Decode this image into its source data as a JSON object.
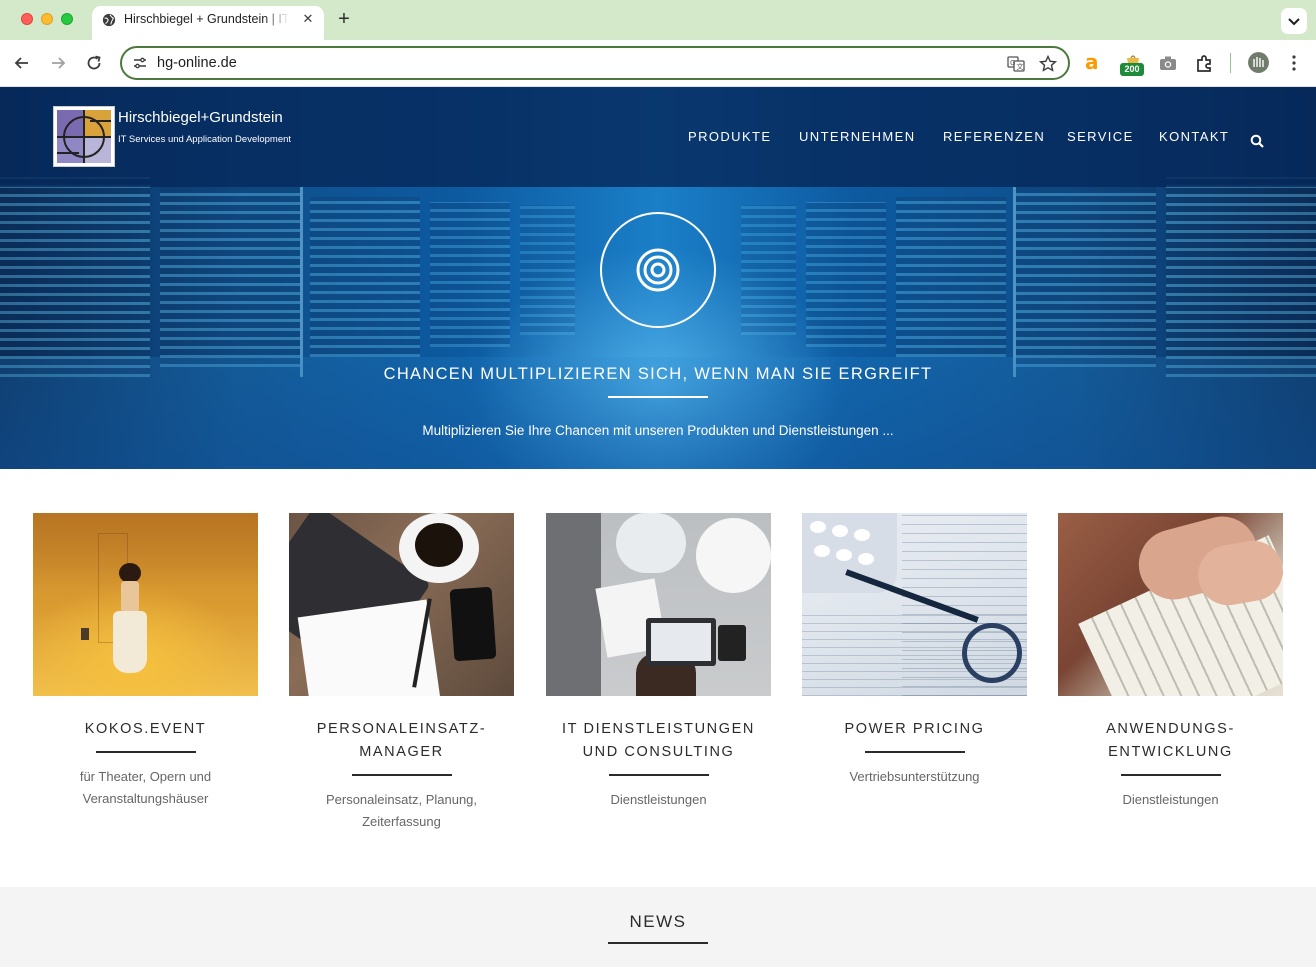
{
  "browser": {
    "tab_title": "Hirschbiegel + Grundstein | IT Services",
    "url": "hg-online.de",
    "extension_badge": "200"
  },
  "site": {
    "logo_name": "Hirschbiegel+Grundstein",
    "logo_tagline": "IT Services und Application Development",
    "menu": [
      "PRODUKTE",
      "UNTERNEHMEN",
      "REFERENZEN",
      "SERVICE",
      "KONTAKT"
    ]
  },
  "hero": {
    "title": "CHANCEN MULTIPLIZIEREN SICH, WENN MAN SIE ERGREIFT",
    "subtitle": "Multiplizieren Sie Ihre Chancen mit unseren Produkten und Dienstleistungen ..."
  },
  "cards": [
    {
      "title": "KOKOS.EVENT",
      "desc": "für Theater, Opern und Veranstaltungshäuser"
    },
    {
      "title": "PERSONALEINSATZ-MANAGER",
      "desc": "Personaleinsatz, Planung, Zeiterfassung"
    },
    {
      "title": "IT DIENSTLEISTUNGEN UND CONSULTING",
      "desc": "Dienstleistungen"
    },
    {
      "title": "POWER PRICING",
      "desc": "Vertriebsunterstützung"
    },
    {
      "title": "ANWENDUNGS-ENTWICKLUNG",
      "desc": "Dienstleistungen"
    }
  ],
  "news": {
    "title": "NEWS"
  },
  "colors": {
    "tabbar": "#d3e9c9",
    "hero_bar": "#062a5a",
    "accent_green": "#4a7a3c"
  }
}
